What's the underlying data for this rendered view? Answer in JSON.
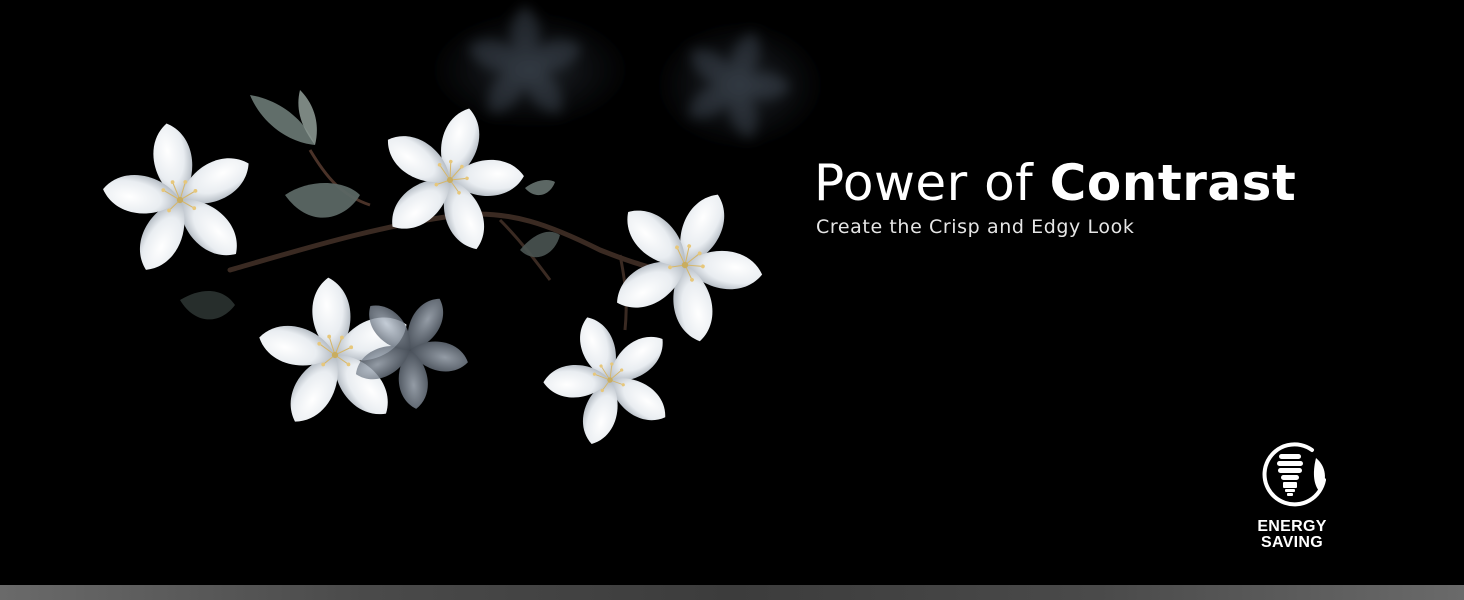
{
  "hero": {
    "headline_regular": "Power of",
    "headline_bold": "Contrast",
    "subheadline": "Create the Crisp and Edgy Look"
  },
  "badge": {
    "icon": "energy-saving-bulb-icon",
    "line1": "ENERGY",
    "line2": "SAVING"
  },
  "colors": {
    "background": "#000000",
    "text": "#ffffff",
    "bottom_bar": "#4a4a4a"
  }
}
